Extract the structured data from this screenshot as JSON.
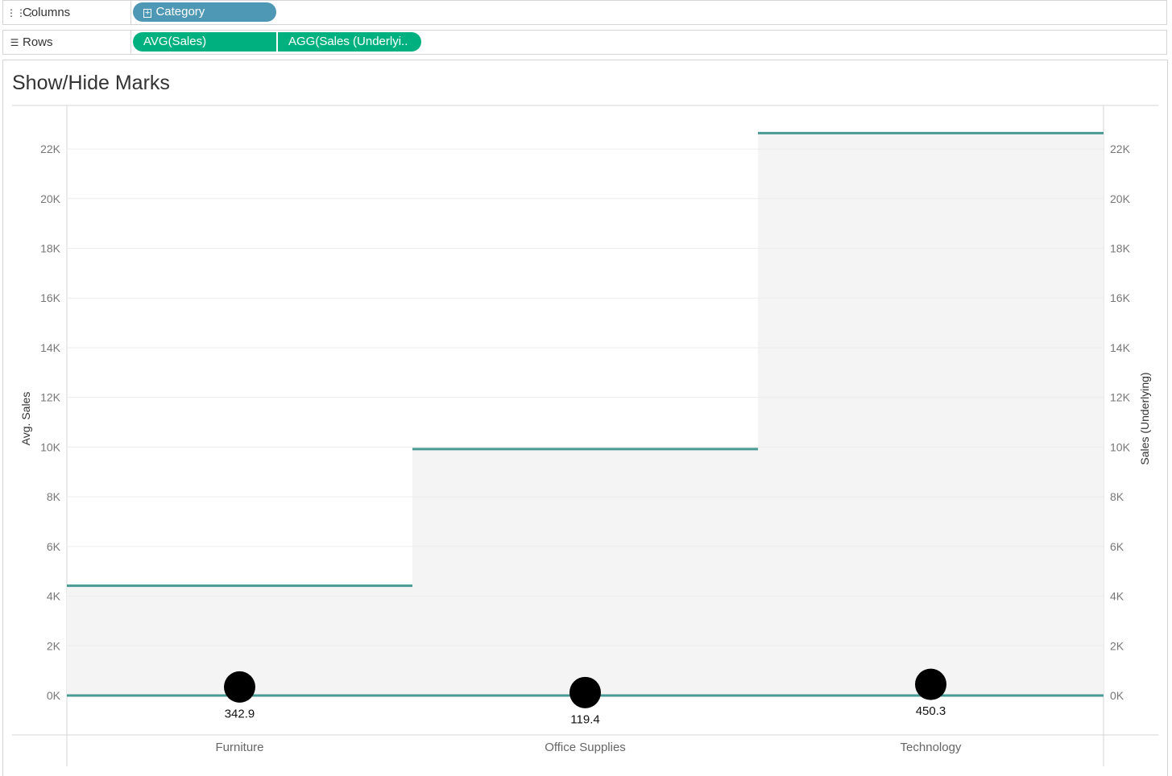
{
  "shelves": {
    "columns_label": "Columns",
    "columns_icon": "columns-icon",
    "rows_label": "Rows",
    "rows_icon": "rows-icon",
    "column_pills": [
      {
        "label": "Category",
        "color": "#4e98b5",
        "icon": "expand-plus-icon"
      }
    ],
    "row_pills": [
      {
        "label": "AVG(Sales)",
        "color": "#00b180"
      },
      {
        "label": "AGG(Sales (Underlyi..",
        "color": "#00b180"
      }
    ]
  },
  "sheet": {
    "title": "Show/Hide Marks"
  },
  "chart_data": {
    "type": "step+scatter",
    "categories": [
      "Furniture",
      "Office Supplies",
      "Technology"
    ],
    "series": [
      {
        "name": "AGG(Sales (Underlying))",
        "axis": "right",
        "mark": "step-line",
        "color": "#4a9a94",
        "values": [
          4420,
          9920,
          22640
        ]
      },
      {
        "name": "AVG(Sales)",
        "axis": "left",
        "mark": "circle",
        "color": "#000000",
        "values": [
          342.9,
          119.4,
          450.3
        ],
        "labels": [
          "342.9",
          "119.4",
          "450.3"
        ]
      }
    ],
    "ylabel": "Avg. Sales",
    "y2label": "Sales (Underlying)",
    "ylim": [
      -1600,
      23800
    ],
    "yticks": [
      0,
      2000,
      4000,
      6000,
      8000,
      10000,
      12000,
      14000,
      16000,
      18000,
      20000,
      22000
    ],
    "ytick_labels": [
      "0K",
      "2K",
      "4K",
      "6K",
      "8K",
      "10K",
      "12K",
      "14K",
      "16K",
      "18K",
      "20K",
      "22K"
    ],
    "grid": true,
    "shade_color": "#f4f4f4"
  }
}
